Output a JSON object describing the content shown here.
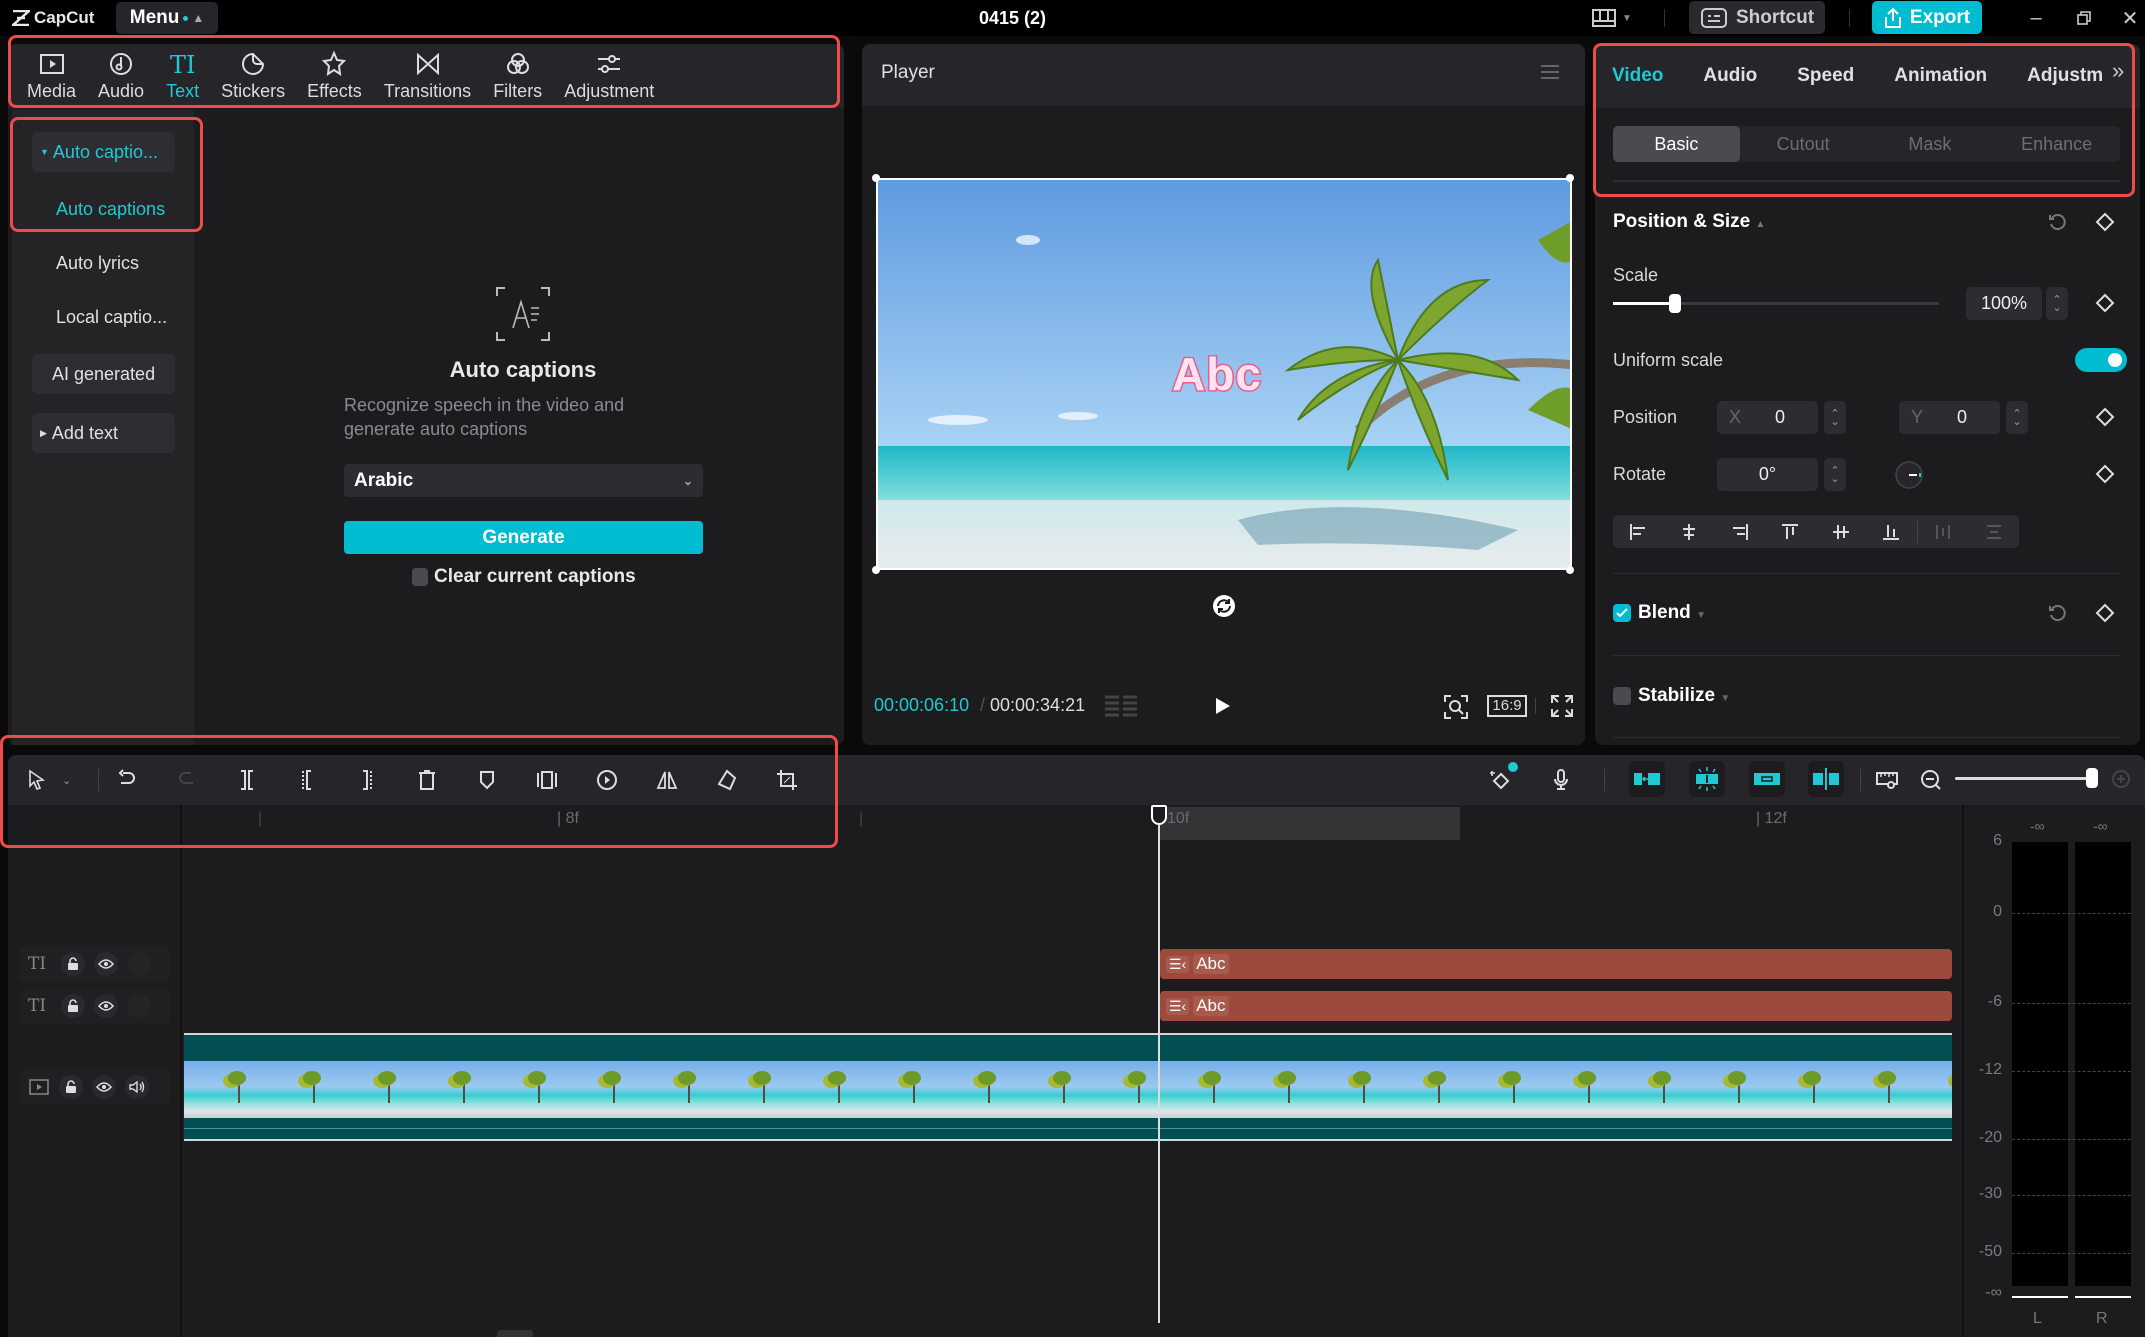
{
  "app": {
    "logo_text": "CapCut",
    "menu_label": "Menu",
    "project_title": "0415 (2)",
    "shortcut_label": "Shortcut",
    "export_label": "Export",
    "brand_color": "#00bcd0"
  },
  "left_tabs": [
    {
      "label": "Media",
      "icon": "media-icon"
    },
    {
      "label": "Audio",
      "icon": "audio-icon"
    },
    {
      "label": "Text",
      "icon": "text-icon",
      "active": true
    },
    {
      "label": "Stickers",
      "icon": "stickers-icon"
    },
    {
      "label": "Effects",
      "icon": "effects-icon"
    },
    {
      "label": "Transitions",
      "icon": "transitions-icon"
    },
    {
      "label": "Filters",
      "icon": "filters-icon"
    },
    {
      "label": "Adjustment",
      "icon": "adjustment-icon"
    }
  ],
  "sidenav": {
    "group_label": "Auto captio...",
    "active_item": "Auto captions",
    "items": [
      "Auto lyrics",
      "Local captio...",
      "AI generated",
      "Add text"
    ]
  },
  "auto_captions": {
    "title": "Auto captions",
    "description": "Recognize speech in the video and generate auto captions",
    "language": "Arabic",
    "generate_label": "Generate",
    "clear_label": "Clear current captions",
    "clear_checked": false
  },
  "player": {
    "title": "Player",
    "overlay_text": "Abc",
    "current_time": "00:00:06:10",
    "duration": "00:00:34:21",
    "aspect_ratio": "16:9"
  },
  "inspector": {
    "tabs": [
      "Video",
      "Audio",
      "Speed",
      "Animation",
      "Adjustm"
    ],
    "active_tab": "Video",
    "subtabs": [
      "Basic",
      "Cutout",
      "Mask",
      "Enhance"
    ],
    "active_subtab": "Basic",
    "position_size_title": "Position & Size",
    "scale_label": "Scale",
    "scale_value": "100%",
    "scale_slider_fraction": 0.19,
    "uniform_scale_label": "Uniform scale",
    "uniform_scale_on": true,
    "position_label": "Position",
    "x_label": "X",
    "x_value": "0",
    "y_label": "Y",
    "y_value": "0",
    "rotate_label": "Rotate",
    "rotate_value": "0°",
    "blend_label": "Blend",
    "blend_checked": true,
    "stabilize_label": "Stabilize",
    "stabilize_checked": false
  },
  "timeline": {
    "ruler_labels": [
      "| 8f",
      "10f",
      "| 12f"
    ],
    "text_clips": [
      {
        "label": "Abc"
      },
      {
        "label": "Abc"
      }
    ],
    "zoom_fraction": 1.0,
    "meter": {
      "top_labels": [
        "-∞",
        "-∞"
      ],
      "scale": [
        "6",
        "0",
        "-6",
        "-12",
        "-20",
        "-30",
        "-50",
        "-∞"
      ],
      "channels": [
        "L",
        "R"
      ]
    }
  }
}
